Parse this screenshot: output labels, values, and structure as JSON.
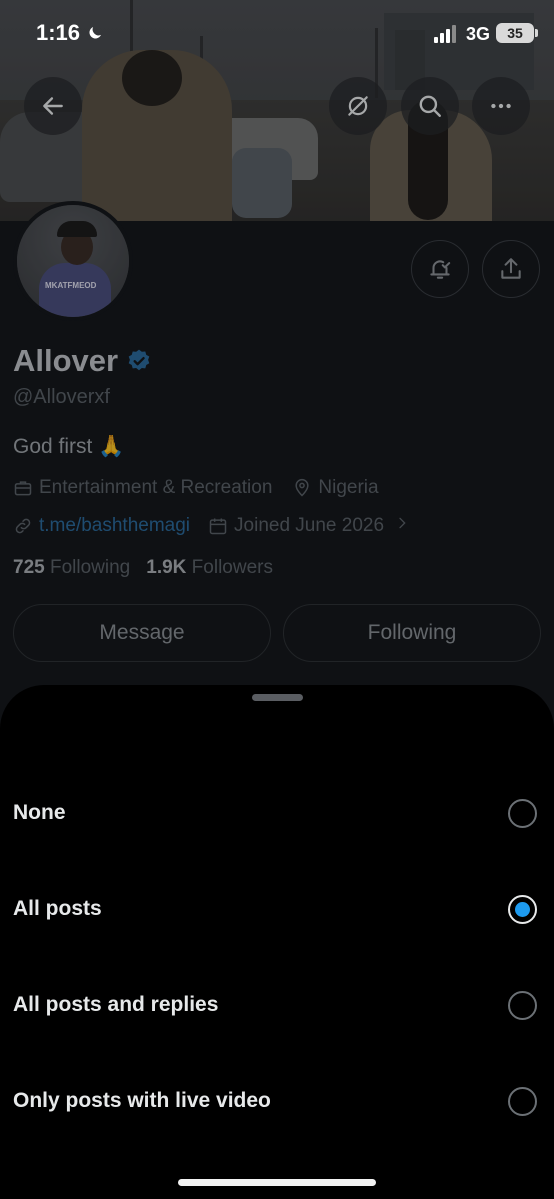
{
  "status_bar": {
    "time": "1:16",
    "network": "3G",
    "battery": "35"
  },
  "profile": {
    "name": "Allover",
    "handle": "@Alloverxf",
    "bio": "God first 🙏",
    "category": "Entertainment & Recreation",
    "location": "Nigeria",
    "link": "t.me/bashthemagi",
    "joined": "Joined June 2026",
    "following_count": "725",
    "following_label": "Following",
    "followers_count": "1.9K",
    "followers_label": "Followers",
    "message_button": "Message",
    "following_button": "Following",
    "avatar_shirt_text": "MKATFMEOD"
  },
  "icons": {
    "back": "arrow-left-icon",
    "grok": "grok-icon",
    "search": "search-icon",
    "more": "more-icon",
    "notify": "bell-icon",
    "share": "share-icon",
    "verified": "verified-badge-icon"
  },
  "notification_sheet": {
    "options": [
      {
        "label": "None",
        "selected": false
      },
      {
        "label": "All posts",
        "selected": true
      },
      {
        "label": "All posts and replies",
        "selected": false
      },
      {
        "label": "Only posts with live video",
        "selected": false
      }
    ]
  },
  "colors": {
    "accent": "#1d9bf0",
    "link": "#1d9bf0",
    "background": "#000000"
  }
}
